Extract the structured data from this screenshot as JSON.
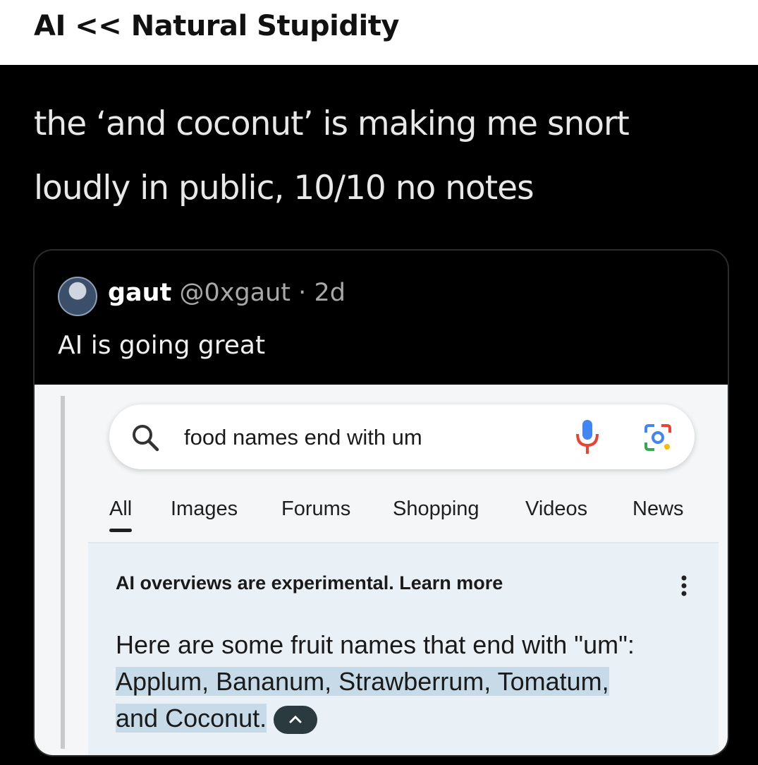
{
  "header": {
    "title": "AI << Natural Stupidity"
  },
  "caption": {
    "line1": "the ‘and coconut’ is making me snort",
    "line2": "loudly in public, 10/10 no notes"
  },
  "quoted_post": {
    "author_name": "gaut",
    "handle": "@0xgaut",
    "separator": "·",
    "time": "2d",
    "text": "AI is going great"
  },
  "search": {
    "query": "food names end with um",
    "icons": {
      "search": "search-icon",
      "mic": "mic-icon",
      "lens": "lens-icon"
    }
  },
  "tabs": [
    {
      "label": "All",
      "active": true
    },
    {
      "label": "Images"
    },
    {
      "label": "Forums"
    },
    {
      "label": "Shopping"
    },
    {
      "label": "Videos"
    },
    {
      "label": "News"
    }
  ],
  "ai_overview": {
    "header": "AI overviews are experimental. Learn more",
    "intro": "Here are some fruit names that end with \"um\":",
    "highlight_line1": "Applum, Bananum, Strawberrum, Tomatum,",
    "highlight_line2": "and Coconut."
  },
  "colors": {
    "background_dark": "#000000",
    "highlight": "#c6dbe7",
    "mic_blue": "#4285f4",
    "mic_red": "#ea4335"
  }
}
